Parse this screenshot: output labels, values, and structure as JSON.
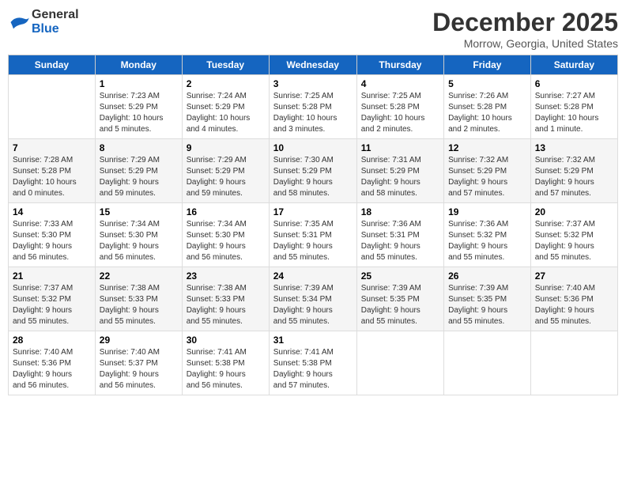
{
  "header": {
    "logo_general": "General",
    "logo_blue": "Blue",
    "title": "December 2025",
    "subtitle": "Morrow, Georgia, United States"
  },
  "columns": [
    "Sunday",
    "Monday",
    "Tuesday",
    "Wednesday",
    "Thursday",
    "Friday",
    "Saturday"
  ],
  "weeks": [
    [
      {
        "num": "",
        "info": ""
      },
      {
        "num": "1",
        "info": "Sunrise: 7:23 AM\nSunset: 5:29 PM\nDaylight: 10 hours\nand 5 minutes."
      },
      {
        "num": "2",
        "info": "Sunrise: 7:24 AM\nSunset: 5:29 PM\nDaylight: 10 hours\nand 4 minutes."
      },
      {
        "num": "3",
        "info": "Sunrise: 7:25 AM\nSunset: 5:28 PM\nDaylight: 10 hours\nand 3 minutes."
      },
      {
        "num": "4",
        "info": "Sunrise: 7:25 AM\nSunset: 5:28 PM\nDaylight: 10 hours\nand 2 minutes."
      },
      {
        "num": "5",
        "info": "Sunrise: 7:26 AM\nSunset: 5:28 PM\nDaylight: 10 hours\nand 2 minutes."
      },
      {
        "num": "6",
        "info": "Sunrise: 7:27 AM\nSunset: 5:28 PM\nDaylight: 10 hours\nand 1 minute."
      }
    ],
    [
      {
        "num": "7",
        "info": "Sunrise: 7:28 AM\nSunset: 5:28 PM\nDaylight: 10 hours\nand 0 minutes."
      },
      {
        "num": "8",
        "info": "Sunrise: 7:29 AM\nSunset: 5:29 PM\nDaylight: 9 hours\nand 59 minutes."
      },
      {
        "num": "9",
        "info": "Sunrise: 7:29 AM\nSunset: 5:29 PM\nDaylight: 9 hours\nand 59 minutes."
      },
      {
        "num": "10",
        "info": "Sunrise: 7:30 AM\nSunset: 5:29 PM\nDaylight: 9 hours\nand 58 minutes."
      },
      {
        "num": "11",
        "info": "Sunrise: 7:31 AM\nSunset: 5:29 PM\nDaylight: 9 hours\nand 58 minutes."
      },
      {
        "num": "12",
        "info": "Sunrise: 7:32 AM\nSunset: 5:29 PM\nDaylight: 9 hours\nand 57 minutes."
      },
      {
        "num": "13",
        "info": "Sunrise: 7:32 AM\nSunset: 5:29 PM\nDaylight: 9 hours\nand 57 minutes."
      }
    ],
    [
      {
        "num": "14",
        "info": "Sunrise: 7:33 AM\nSunset: 5:30 PM\nDaylight: 9 hours\nand 56 minutes."
      },
      {
        "num": "15",
        "info": "Sunrise: 7:34 AM\nSunset: 5:30 PM\nDaylight: 9 hours\nand 56 minutes."
      },
      {
        "num": "16",
        "info": "Sunrise: 7:34 AM\nSunset: 5:30 PM\nDaylight: 9 hours\nand 56 minutes."
      },
      {
        "num": "17",
        "info": "Sunrise: 7:35 AM\nSunset: 5:31 PM\nDaylight: 9 hours\nand 55 minutes."
      },
      {
        "num": "18",
        "info": "Sunrise: 7:36 AM\nSunset: 5:31 PM\nDaylight: 9 hours\nand 55 minutes."
      },
      {
        "num": "19",
        "info": "Sunrise: 7:36 AM\nSunset: 5:32 PM\nDaylight: 9 hours\nand 55 minutes."
      },
      {
        "num": "20",
        "info": "Sunrise: 7:37 AM\nSunset: 5:32 PM\nDaylight: 9 hours\nand 55 minutes."
      }
    ],
    [
      {
        "num": "21",
        "info": "Sunrise: 7:37 AM\nSunset: 5:32 PM\nDaylight: 9 hours\nand 55 minutes."
      },
      {
        "num": "22",
        "info": "Sunrise: 7:38 AM\nSunset: 5:33 PM\nDaylight: 9 hours\nand 55 minutes."
      },
      {
        "num": "23",
        "info": "Sunrise: 7:38 AM\nSunset: 5:33 PM\nDaylight: 9 hours\nand 55 minutes."
      },
      {
        "num": "24",
        "info": "Sunrise: 7:39 AM\nSunset: 5:34 PM\nDaylight: 9 hours\nand 55 minutes."
      },
      {
        "num": "25",
        "info": "Sunrise: 7:39 AM\nSunset: 5:35 PM\nDaylight: 9 hours\nand 55 minutes."
      },
      {
        "num": "26",
        "info": "Sunrise: 7:39 AM\nSunset: 5:35 PM\nDaylight: 9 hours\nand 55 minutes."
      },
      {
        "num": "27",
        "info": "Sunrise: 7:40 AM\nSunset: 5:36 PM\nDaylight: 9 hours\nand 55 minutes."
      }
    ],
    [
      {
        "num": "28",
        "info": "Sunrise: 7:40 AM\nSunset: 5:36 PM\nDaylight: 9 hours\nand 56 minutes."
      },
      {
        "num": "29",
        "info": "Sunrise: 7:40 AM\nSunset: 5:37 PM\nDaylight: 9 hours\nand 56 minutes."
      },
      {
        "num": "30",
        "info": "Sunrise: 7:41 AM\nSunset: 5:38 PM\nDaylight: 9 hours\nand 56 minutes."
      },
      {
        "num": "31",
        "info": "Sunrise: 7:41 AM\nSunset: 5:38 PM\nDaylight: 9 hours\nand 57 minutes."
      },
      {
        "num": "",
        "info": ""
      },
      {
        "num": "",
        "info": ""
      },
      {
        "num": "",
        "info": ""
      }
    ]
  ]
}
